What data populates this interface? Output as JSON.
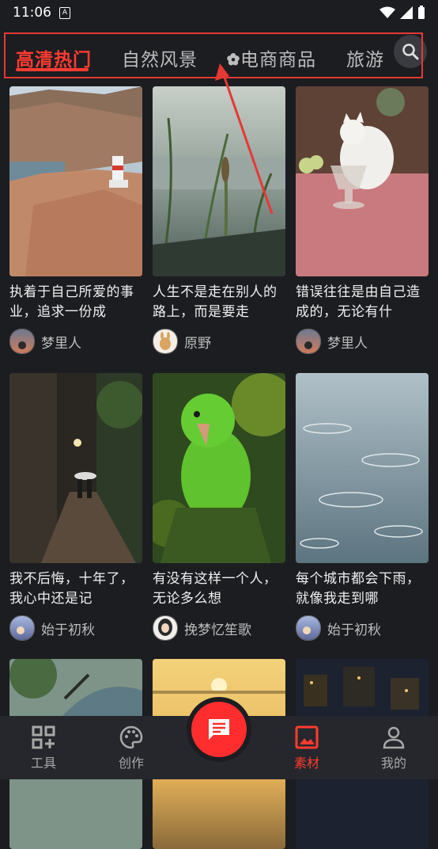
{
  "status": {
    "time": "11:06",
    "notification_glyph": "A"
  },
  "tabs": [
    {
      "label": "高清热门",
      "active": true
    },
    {
      "label": "自然风景",
      "active": false
    },
    {
      "label": "电商商品",
      "active": false,
      "icon": "flower-icon"
    },
    {
      "label": "旅游",
      "active": false
    }
  ],
  "cards": [
    {
      "title": "执着于自己所爱的事业，追求一份成",
      "author": "梦里人",
      "thumb": "lighthouse-coast"
    },
    {
      "title": "人生不是走在别人的路上，而是要走",
      "author": "原野",
      "thumb": "grass-lake"
    },
    {
      "title": "错误往往是由自己造成的，无论有什",
      "author": "梦里人",
      "thumb": "cat-table"
    },
    {
      "title": "我不后悔，十年了，我心中还是记",
      "author": "始于初秋",
      "thumb": "rainy-alley"
    },
    {
      "title": "有没有这样一个人，无论多么想",
      "author": "挽梦忆笙歌",
      "thumb": "green-parrot"
    },
    {
      "title": "每个城市都会下雨，就像我走到哪",
      "author": "始于初秋",
      "thumb": "rain-water"
    },
    {
      "title": "",
      "author": "",
      "thumb": "umbrella-rain"
    },
    {
      "title": "",
      "author": "",
      "thumb": "sunset-sea"
    },
    {
      "title": "",
      "author": "",
      "thumb": "city-night"
    }
  ],
  "nav": {
    "tools": "工具",
    "create": "创作",
    "material": "素材",
    "mine": "我的"
  },
  "colors": {
    "accent": "#ff3b30",
    "background": "#1c1d21",
    "nav_bg": "#26272c"
  }
}
